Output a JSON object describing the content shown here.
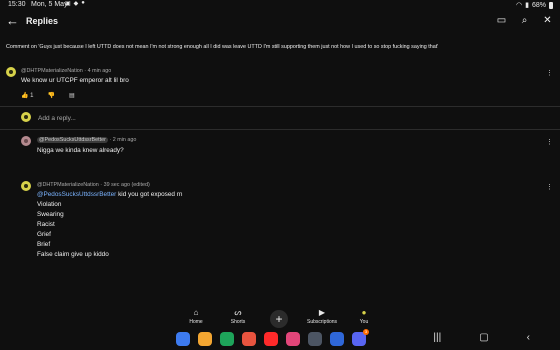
{
  "status": {
    "time": "15:30",
    "date": "Mon, 5 May",
    "battery": "68%"
  },
  "appbar": {
    "title": "Replies"
  },
  "headline": "Comment on 'Guys just because I left UTTD does not mean I'm not strong enough all I did was leave UTTD I'm still supporting them just not how I used to so stop fucking saying that'",
  "comments": [
    {
      "author": "@DHTPMaterializeNation",
      "time": "4 min ago",
      "text": "We know ur UTCPF emperor alt lil bro",
      "likes": "1"
    },
    {
      "mention": "@PedosSucksUttdssrBetter",
      "time": "2 min ago",
      "text": "Nigga we kinda knew already?"
    },
    {
      "author": "@DHTPMaterializeNation",
      "time": "39 sec ago (edited)",
      "mention": "@PedosSucksUttdssrBetter",
      "first_line": "kid you got exposed rn",
      "lines": [
        "Violation",
        "Swearing",
        "Racist",
        "Grief",
        "Brief",
        "False claim give up kiddo"
      ]
    }
  ],
  "reply_placeholder": "Add a reply...",
  "bottom_nav": [
    {
      "label": "Home",
      "icon": "home-icon"
    },
    {
      "label": "Shorts",
      "icon": "shorts-icon"
    },
    {
      "label": "Subscriptions",
      "icon": "subscriptions-icon"
    },
    {
      "label": "You",
      "icon": "you-avatar-icon"
    }
  ],
  "dock_apps": [
    {
      "name": "samsung-internet-icon",
      "color": "#3d7bf0"
    },
    {
      "name": "my-files-icon",
      "color": "#f3a632"
    },
    {
      "name": "phone-icon",
      "color": "#1ea45a"
    },
    {
      "name": "contacts-icon",
      "color": "#e8543f"
    },
    {
      "name": "youtube-icon",
      "color": "#ff2a2a"
    },
    {
      "name": "video-player-icon",
      "color": "#e2467a"
    },
    {
      "name": "calculator-icon",
      "color": "#4c5563"
    },
    {
      "name": "roblox-icon",
      "color": "#2f67d8"
    },
    {
      "name": "discord-icon",
      "color": "#5865f2"
    }
  ],
  "discord_badge": "3"
}
